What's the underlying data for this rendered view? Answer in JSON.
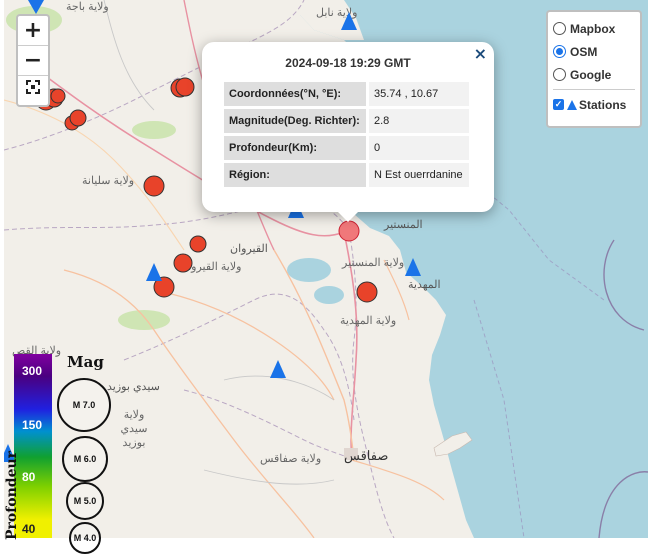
{
  "controls": {
    "zoom_in": "+",
    "zoom_out": "−",
    "fullscreen_icon": "fullscreen-icon"
  },
  "popup": {
    "title": "2024-09-18 19:29 GMT",
    "close": "×",
    "rows": [
      {
        "label": "Coordonnées(°N, °E):",
        "value": "35.74 , 10.67"
      },
      {
        "label": "Magnitude(Deg. Richter):",
        "value": "2.8"
      },
      {
        "label": "Profondeur(Km):",
        "value": "0"
      },
      {
        "label": "Région:",
        "value": "N Est ouerrdanine"
      }
    ]
  },
  "layers": {
    "options": [
      "Mapbox",
      "OSM",
      "Google"
    ],
    "selected": "OSM",
    "overlay": "Stations",
    "overlay_checked": true
  },
  "legend": {
    "depth_title": "Profondeur",
    "depth_ticks": [
      "300",
      "150",
      "80",
      "40"
    ],
    "mag_title": "Mag",
    "mag_labels": [
      "M 7.0",
      "M 6.0",
      "M 5.0",
      "M 4.0"
    ]
  },
  "places": {
    "monastir_ar": "المنستير",
    "monastir_gov": "ولاية المنستير",
    "mahdia": "المهدية",
    "mahdia_gov": "ولاية المهدية",
    "kairouan": "القيروان",
    "kairouan_gov": "ولاية القيروان",
    "sfax": "صفاقس",
    "sfax_gov": "ولاية صفاقس",
    "sidi_bouzid": "سيدي بوزيد",
    "sidi_bouzid_gov": "ولاية سيدي بوزيد",
    "siliana_gov": "ولاية سليانة",
    "beja_gov": "ولاية باجة",
    "nabeul_gov": "ولاية نابل",
    "kasserine_short": "ولاية القص"
  },
  "colors": {
    "sea": "#aad3df",
    "land": "#f2efe9",
    "event": "#e8432a",
    "selected_event": "#f0787a",
    "station": "#1a73e8"
  }
}
